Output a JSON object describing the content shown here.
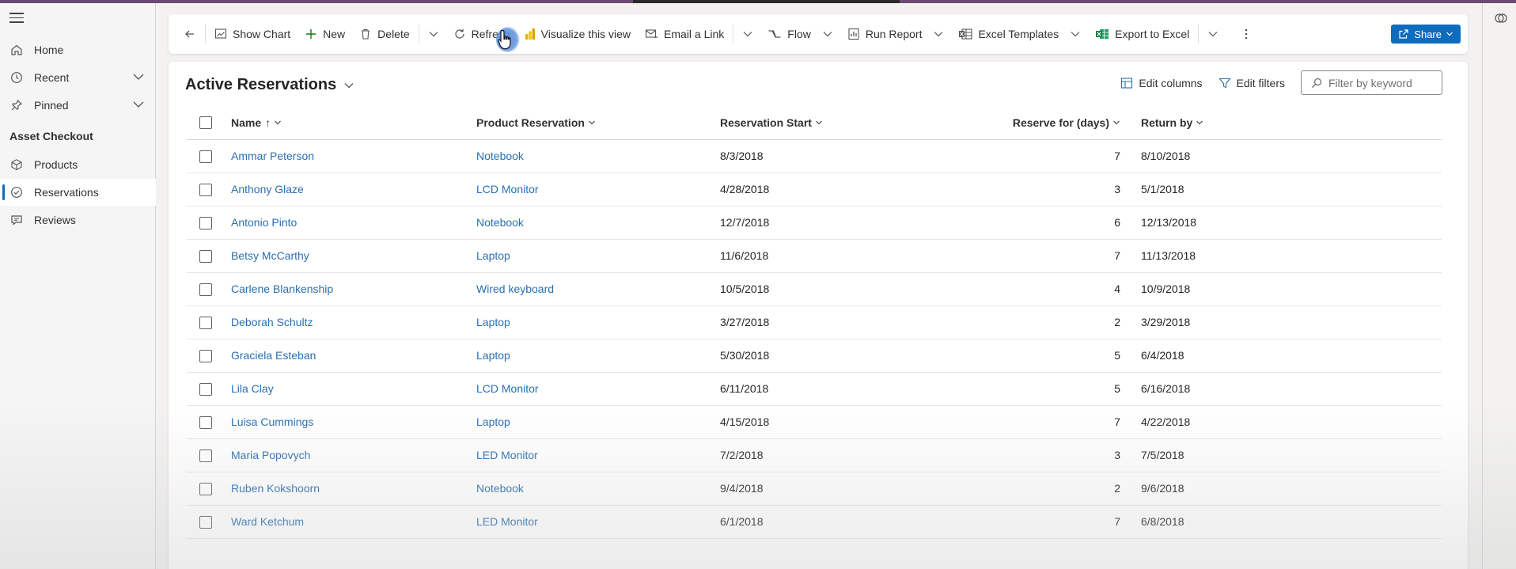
{
  "sidebar": {
    "items": [
      {
        "label": "Home",
        "icon": "home-icon"
      },
      {
        "label": "Recent",
        "icon": "clock-icon"
      },
      {
        "label": "Pinned",
        "icon": "pin-icon"
      }
    ],
    "section_title": "Asset Checkout",
    "section_items": [
      {
        "label": "Products",
        "icon": "cube-icon"
      },
      {
        "label": "Reservations",
        "icon": "check-circle-icon",
        "active": true
      },
      {
        "label": "Reviews",
        "icon": "comment-icon"
      }
    ]
  },
  "commands": {
    "show_chart": "Show Chart",
    "new": "New",
    "delete": "Delete",
    "refresh": "Refresh",
    "visualize": "Visualize this view",
    "email_link": "Email a Link",
    "flow": "Flow",
    "run_report": "Run Report",
    "excel_templates": "Excel Templates",
    "export_excel": "Export to Excel",
    "share": "Share"
  },
  "view": {
    "title": "Active Reservations",
    "edit_columns": "Edit columns",
    "edit_filters": "Edit filters",
    "filter_placeholder": "Filter by keyword"
  },
  "table": {
    "headers": {
      "name": "Name",
      "name_sort": "↑",
      "product": "Product Reservation",
      "start": "Reservation Start",
      "days": "Reserve for (days)",
      "return_by": "Return by"
    },
    "rows": [
      {
        "name": "Ammar Peterson",
        "product": "Notebook",
        "start": "8/3/2018",
        "days": "7",
        "return_by": "8/10/2018"
      },
      {
        "name": "Anthony Glaze",
        "product": "LCD Monitor",
        "start": "4/28/2018",
        "days": "3",
        "return_by": "5/1/2018"
      },
      {
        "name": "Antonio Pinto",
        "product": "Notebook",
        "start": "12/7/2018",
        "days": "6",
        "return_by": "12/13/2018"
      },
      {
        "name": "Betsy McCarthy",
        "product": "Laptop",
        "start": "11/6/2018",
        "days": "7",
        "return_by": "11/13/2018"
      },
      {
        "name": "Carlene Blankenship",
        "product": "Wired keyboard",
        "start": "10/5/2018",
        "days": "4",
        "return_by": "10/9/2018"
      },
      {
        "name": "Deborah Schultz",
        "product": "Laptop",
        "start": "3/27/2018",
        "days": "2",
        "return_by": "3/29/2018"
      },
      {
        "name": "Graciela Esteban",
        "product": "Laptop",
        "start": "5/30/2018",
        "days": "5",
        "return_by": "6/4/2018"
      },
      {
        "name": "Lila Clay",
        "product": "LCD Monitor",
        "start": "6/11/2018",
        "days": "5",
        "return_by": "6/16/2018"
      },
      {
        "name": "Luisa Cummings",
        "product": "Laptop",
        "start": "4/15/2018",
        "days": "7",
        "return_by": "4/22/2018"
      },
      {
        "name": "Maria Popovych",
        "product": "LED Monitor",
        "start": "7/2/2018",
        "days": "3",
        "return_by": "7/5/2018"
      },
      {
        "name": "Ruben Kokshoorn",
        "product": "Notebook",
        "start": "9/4/2018",
        "days": "2",
        "return_by": "9/6/2018"
      },
      {
        "name": "Ward Ketchum",
        "product": "LED Monitor",
        "start": "6/1/2018",
        "days": "7",
        "return_by": "6/8/2018"
      }
    ]
  },
  "colors": {
    "accent": "#0f6cbd",
    "link": "#2a6fb0",
    "top_strip": "#6b4a72"
  }
}
